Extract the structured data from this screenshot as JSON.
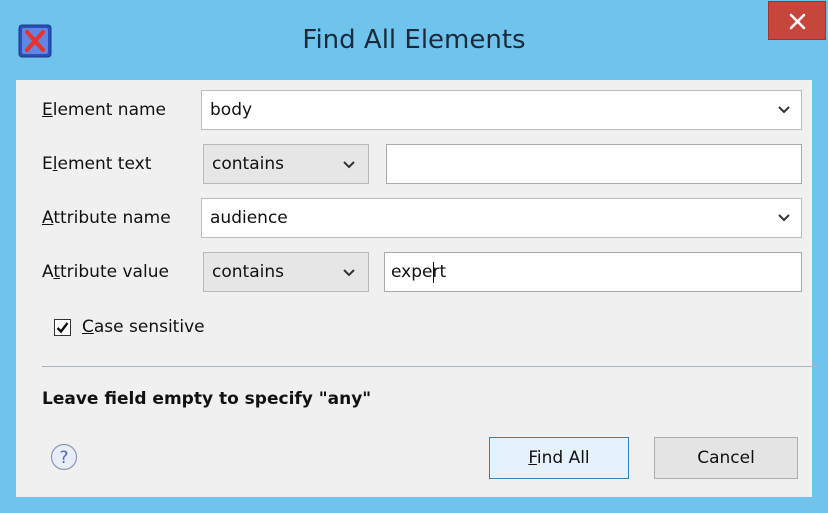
{
  "window": {
    "title": "Find All Elements",
    "close_symbol": "✕"
  },
  "form": {
    "element_name": {
      "label_accel": "E",
      "label_rest": "lement name",
      "value": "body"
    },
    "element_text": {
      "label_pre": "E",
      "label_accel": "l",
      "label_rest": "ement text",
      "operator": "contains",
      "value": ""
    },
    "attribute_name": {
      "label_accel": "A",
      "label_rest": "ttribute name",
      "value": "audience"
    },
    "attribute_value": {
      "label_pre": "A",
      "label_accel": "t",
      "label_rest": "tribute value",
      "operator": "contains",
      "value_before_caret": "expe",
      "value_after_caret": "rt"
    },
    "case_sensitive": {
      "checked": true,
      "label_accel": "C",
      "label_rest": "ase sensitive"
    }
  },
  "hint": "Leave field empty to specify \"any\"",
  "buttons": {
    "find_all_accel": "F",
    "find_all_rest": "ind All",
    "cancel": "Cancel"
  },
  "icons": {
    "app": "oxygen-x-icon",
    "help": "help-icon",
    "close": "close-icon",
    "dropdown": "chevron-down-icon",
    "check": "checkmark-icon"
  },
  "colors": {
    "frame": "#6fc4ee",
    "close": "#c7463b",
    "panel": "#f0f0f0",
    "default_button_border": "#3c7fb1"
  }
}
